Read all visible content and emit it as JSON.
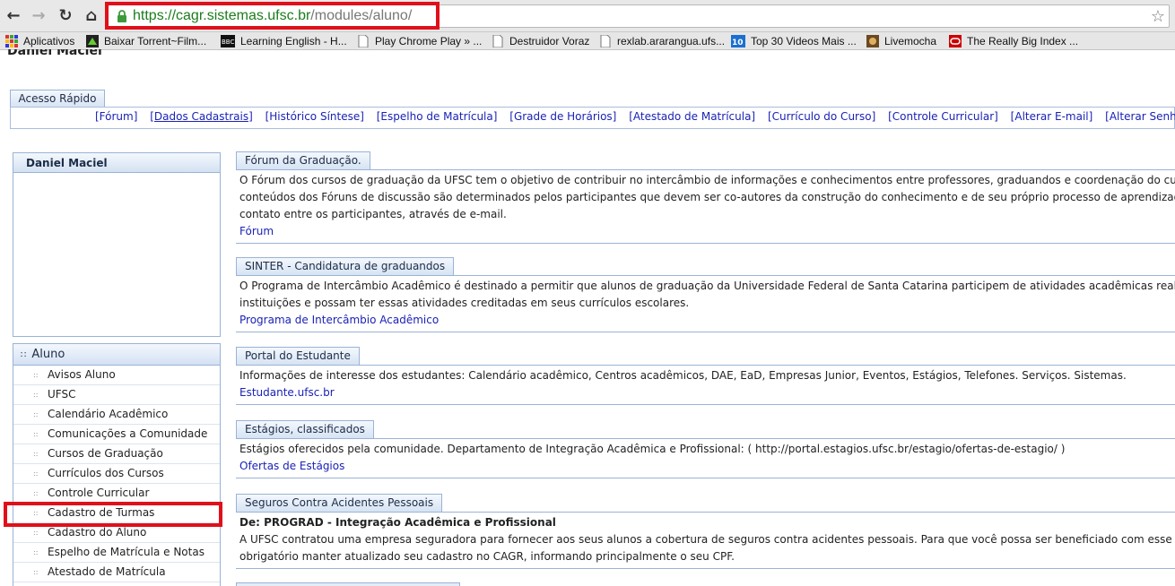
{
  "browser": {
    "url_base": "https://cagr.sistemas.ufsc.br",
    "url_path": "/modules/aluno/",
    "bookmarks": [
      {
        "label": "Aplicativos",
        "icon": "apps-grid-icon"
      },
      {
        "label": "Baixar Torrent~Film...",
        "icon": "torrent-favicon"
      },
      {
        "label": "Learning English - H...",
        "icon": "bbc-favicon"
      },
      {
        "label": "Play Chrome Play » ...",
        "icon": "page-icon"
      },
      {
        "label": "Destruidor Voraz",
        "icon": "page-icon"
      },
      {
        "label": "rexlab.ararangua.ufs...",
        "icon": "page-icon"
      },
      {
        "label": "Top 30 Videos Mais ...",
        "icon": "ten-plus-favicon"
      },
      {
        "label": "Livemocha",
        "icon": "livemocha-favicon"
      },
      {
        "label": "The Really Big Index ...",
        "icon": "oracle-favicon"
      }
    ]
  },
  "page": {
    "user_name": "Daniel Maciel",
    "quick_access": {
      "tab_label": "Acesso Rápido",
      "links": [
        "[Fórum]",
        "[Dados Cadastrais]",
        "[Histórico Síntese]",
        "[Espelho de Matrícula]",
        "[Grade de Horários]",
        "[Atestado de Matrícula]",
        "[Currículo do Curso]",
        "[Controle Curricular]",
        "[Alterar E-mail]",
        "[Alterar Senha]"
      ]
    },
    "user_panel_title": "Daniel Maciel",
    "aluno_menu": {
      "title": "Aluno",
      "items": [
        "Avisos Aluno",
        "UFSC",
        "Calendário Acadêmico",
        "Comunicações a Comunidade",
        "Cursos de Graduação",
        "Currículos dos Cursos",
        "Controle Curricular",
        "Cadastro de Turmas",
        "Cadastro do Aluno",
        "Espelho de Matrícula e Notas",
        "Atestado de Matrícula"
      ]
    },
    "sections": {
      "forum": {
        "title": "Fórum da Graduação.",
        "lines": [
          "O Fórum dos cursos de graduação da UFSC tem o objetivo de contribuir no intercâmbio de informações e conhecimentos entre professores, graduandos e coordenação do curso. Os",
          "conteúdos dos Fóruns de discussão são determinados pelos participantes que devem ser co-autores da construção do conhecimento e de seu próprio processo de aprendizagem. Possibilita",
          "contato entre os participantes, através de e-mail."
        ],
        "link": "Fórum"
      },
      "sinter": {
        "title": "SINTER - Candidatura de graduandos",
        "lines": [
          "O Programa de Intercâmbio Acadêmico é destinado a permitir que alunos de graduação da Universidade Federal de Santa Catarina participem de atividades acadêmicas realizadas em outras",
          "instituições e possam ter essas atividades creditadas em seus currículos escolares."
        ],
        "link": "Programa de Intercâmbio Acadêmico"
      },
      "portal": {
        "title": "Portal do Estudante",
        "lines": [
          "Informações de interesse dos estudantes: Calendário acadêmico, Centros acadêmicos, DAE, EaD, Empresas Junior, Eventos, Estágios, Telefones. Serviços. Sistemas."
        ],
        "link": "Estudante.ufsc.br"
      },
      "estagios": {
        "title": "Estágios, classificados",
        "lines": [
          "Estágios oferecidos pela comunidade. Departamento de Integração Acadêmica e Profissional: ( http://portal.estagios.ufsc.br/estagio/ofertas-de-estagio/ )"
        ],
        "link": "Ofertas de Estágios"
      },
      "seguros": {
        "title": "Seguros Contra Acidentes Pessoais",
        "from": "De: PROGRAD - Integração Acadêmica e Profissional",
        "lines": [
          "A UFSC contratou uma empresa seguradora para fornecer aos seus alunos a cobertura de seguros contra acidentes pessoais. Para que você possa ser beneficiado com esse seguro é",
          "obrigatório manter atualizado seu cadastro no CAGR, informando principalmente o seu CPF."
        ]
      }
    }
  },
  "colors": {
    "link": "#1a22b6",
    "highlight": "#e0101a",
    "panel_border": "#9ab3d5"
  }
}
